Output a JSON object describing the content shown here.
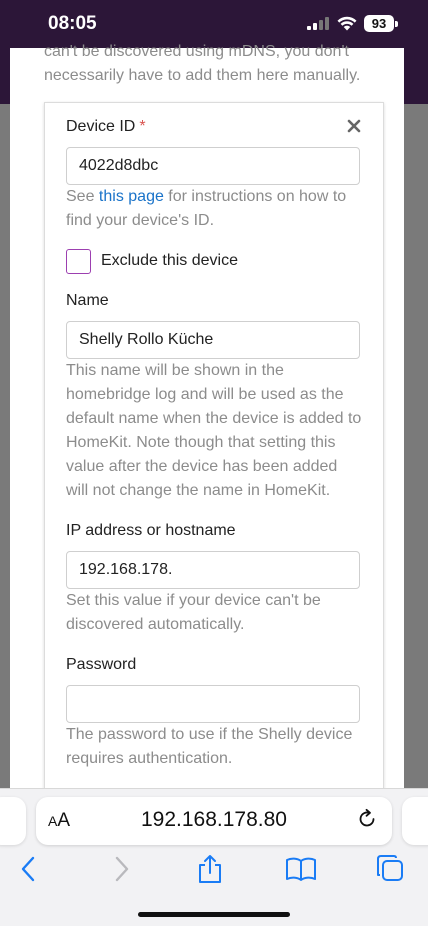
{
  "status_bar": {
    "time": "08:05",
    "battery": "93"
  },
  "intro": {
    "text": "can't be discovered using mDNS, you don't necessarily have to add them here manually."
  },
  "device_id": {
    "label": "Device ID",
    "required_marker": "*",
    "value": "4022d8dbc",
    "help_prefix": "See ",
    "help_link": "this page",
    "help_suffix": " for instructions on how to find your device's ID."
  },
  "exclude": {
    "label": "Exclude this device",
    "checked": false
  },
  "name": {
    "label": "Name",
    "value": "Shelly Rollo Küche",
    "help": "This name will be shown in the homebridge log and will be used as the default name when the device is added to HomeKit. Note though that setting this value after the device has been added will not change the name in HomeKit."
  },
  "ip": {
    "label": "IP address or hostname",
    "value": "192.168.178.",
    "help": "Set this value if your device can't be discovered automatically."
  },
  "password": {
    "label": "Password",
    "value": "",
    "help": "The password to use if the Shelly device requires authentication."
  },
  "browser": {
    "aa_big": "A",
    "aa_small": "A",
    "url": "192.168.178.80"
  },
  "colors": {
    "header_purple": "#2c1638",
    "checkbox_border": "#9c3fb0",
    "link_blue": "#1a73c9",
    "required_red": "#d9534f",
    "ios_blue": "#1a7cf5"
  }
}
